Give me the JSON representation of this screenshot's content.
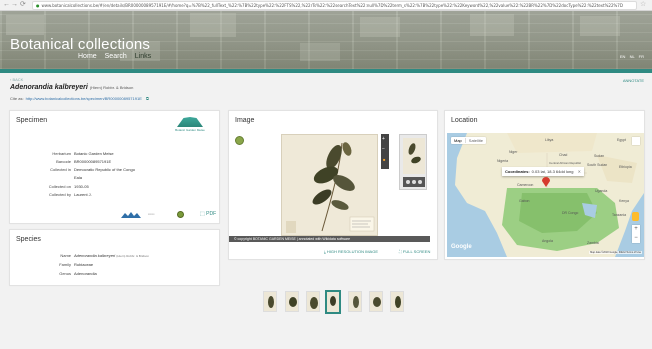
{
  "browser": {
    "url": "www.botanicalcollections.be/#/en/details/BR0000008957191E/#/home?q=%7B%22_fullText_%22:%7B%22type%22:%22FTS%22,%22rTs%22:%22searchText%22:null%7D%22term_s%22:%7B%22type%22:%22Keyword%22,%22value%22:%22BR%22%7D%22docType%22:%22text%22%7D"
  },
  "header": {
    "site_title": "Botanical collections",
    "nav": {
      "home": "Home",
      "search": "Search",
      "links": "Links"
    },
    "languages": [
      "EN",
      "NL",
      "FR"
    ]
  },
  "record": {
    "back_label": "BACK",
    "annotate_label": "ANNOTATE",
    "species_name": "Adenorandia kalbreyeri",
    "species_author": "(Hiern) Robbr. & Bridson",
    "cite_label": "Cite as:",
    "cite_url": "http://www.botanicalcollections.be/specimen/BR0000008957191E"
  },
  "specimen": {
    "title": "Specimen",
    "garden_logo_text": "Botanic Garden Meise",
    "fields": [
      {
        "key": "Herbarium",
        "value": "Botanic Garden Meise"
      },
      {
        "key": "Barcode",
        "value": "BR0000008957191E"
      },
      {
        "key": "Collected in",
        "value": "Democratic Republic of the Congo"
      },
      {
        "key": "",
        "value": "Eala"
      },
      {
        "key": "Collected on",
        "value": "1930-05"
      },
      {
        "key": "Collected by",
        "value": "Laurent J."
      }
    ],
    "footer_link": "PDF"
  },
  "species": {
    "title": "Species",
    "fields": [
      {
        "key": "Name",
        "value": "Adenorandia kalbreyeri",
        "extra": "(Hiern) Robbr. & Bridson"
      },
      {
        "key": "Family",
        "value": "Rubiaceae"
      },
      {
        "key": "Genus",
        "value": "Adenorandia"
      }
    ]
  },
  "image": {
    "title": "Image",
    "copyright": "© copyright BOTANIC GARDEN MEISE | annotated with Wikidata software",
    "hires_label": "HIGH RESOLUTION IMAGE",
    "fullscreen_label": "FULL SCREEN"
  },
  "location": {
    "title": "Location",
    "map_type": {
      "map": "Map",
      "satellite": "Satellite"
    },
    "coordinates_label": "Coordinates:",
    "coordinates_value": "0.03 lat, 18.3 64dd long",
    "labels": [
      "Libya",
      "Egypt",
      "Niger",
      "Chad",
      "Sudan",
      "Nigeria",
      "Ethiopia",
      "Central African Republic",
      "South Sudan",
      "Cameroon",
      "Gabon",
      "Uganda",
      "Kenya",
      "DR Congo",
      "Tanzania",
      "Angola",
      "Zambia"
    ],
    "google": "Google",
    "credits": "Map data ©2018 Google, INEGI    Terms of Use"
  },
  "thumbnails": {
    "count": 7,
    "active_index": 3
  },
  "colors": {
    "accent": "#2f8a82",
    "header_bg": "#9ea394",
    "map_water": "#a9cce3",
    "map_land": "#f0ecd5",
    "map_green": "#9ccf84"
  }
}
